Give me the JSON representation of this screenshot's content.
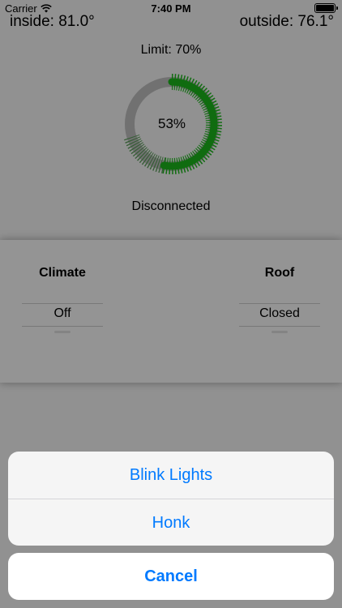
{
  "status_bar": {
    "carrier": "Carrier",
    "time": "7:40 PM",
    "wifi_icon": "wifi-icon",
    "battery_icon": "battery-icon"
  },
  "temperatures": {
    "inside": "inside:  81.0°",
    "outside": "outside:  76.1°"
  },
  "charge": {
    "limit_label": "Limit: 70%",
    "level_label": "53%",
    "level_fraction": 0.53,
    "limit_fraction": 0.7,
    "connection_status": "Disconnected",
    "colors": {
      "charged": "#1bb41b",
      "limit_band": "#5a9c5a",
      "empty": "#bdbdbd"
    }
  },
  "controls": {
    "climate": {
      "title": "Climate",
      "value": "Off"
    },
    "roof": {
      "title": "Roof",
      "value": "Closed"
    }
  },
  "action_sheet": {
    "actions": [
      {
        "label": "Blink Lights"
      },
      {
        "label": "Honk"
      }
    ],
    "cancel_label": "Cancel",
    "accent_color": "#007aff"
  }
}
